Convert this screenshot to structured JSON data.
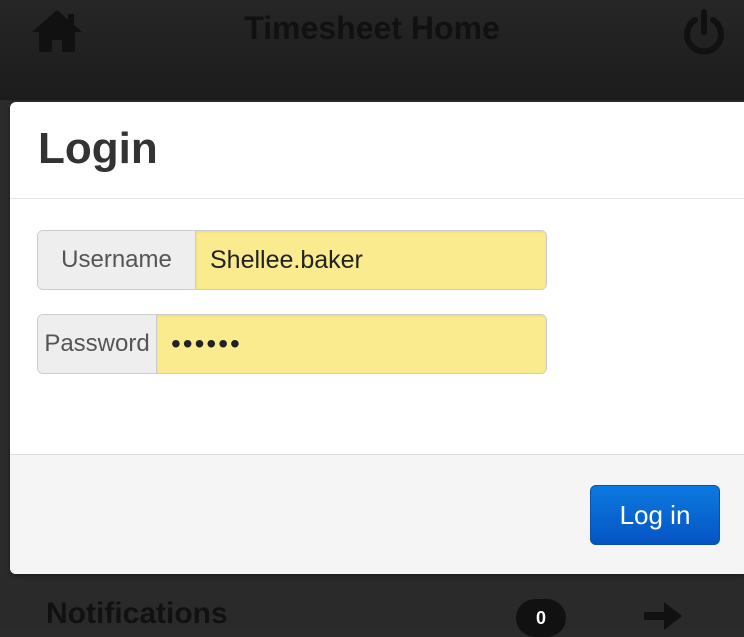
{
  "top_bar": {
    "title": "Timesheet Home",
    "home_icon": "home-icon",
    "power_icon": "power-icon"
  },
  "login_dialog": {
    "title": "Login",
    "username_label": "Username",
    "username_value": "Shellee.baker",
    "password_label": "Password",
    "password_value": "••••••",
    "submit_label": "Log in"
  },
  "bottom_bar": {
    "notifications_label": "Notifications",
    "notifications_count": "0",
    "arrow_icon": "arrow-right-icon"
  },
  "colors": {
    "autofill_yellow": "#faeb8f",
    "primary_button": "#0866d4",
    "bar_background": "#1f1f1f"
  }
}
